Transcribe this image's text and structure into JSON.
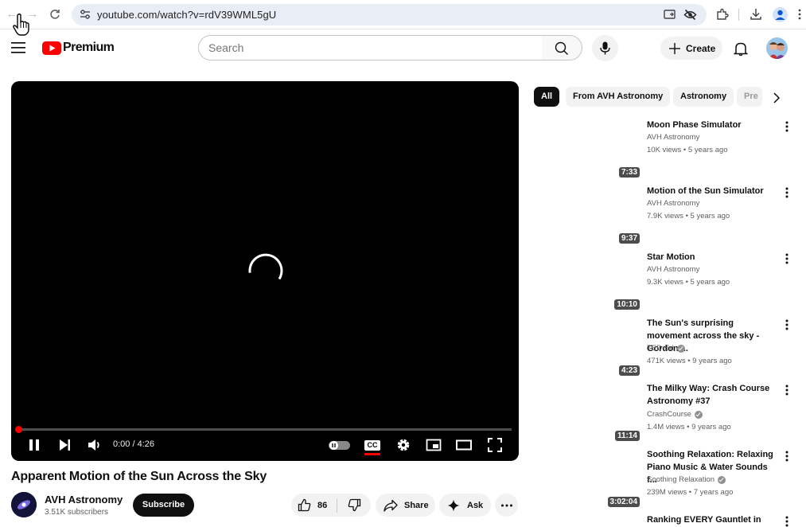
{
  "browser": {
    "url": "youtube.com/watch?v=rdV39WML5gU"
  },
  "header": {
    "logo_text": "Premium",
    "search_placeholder": "Search",
    "create_label": "Create"
  },
  "player": {
    "time": "0:00 / 4:26",
    "progress": 0.0
  },
  "video": {
    "title": "Apparent Motion of the Sun Across the Sky",
    "channel": "AVH Astronomy",
    "subscribers": "3.51K subscribers",
    "subscribe_label": "Subscribe",
    "likes": "86",
    "share_label": "Share",
    "ask_label": "Ask"
  },
  "chips": [
    "All",
    "From AVH Astronomy",
    "Astronomy",
    "Pre"
  ],
  "recommended": [
    {
      "title": "Moon Phase Simulator",
      "channel": "AVH Astronomy",
      "verified": false,
      "meta": "10K views • 5 years ago",
      "duration": "7:33"
    },
    {
      "title": "Motion of the Sun Simulator",
      "channel": "AVH Astronomy",
      "verified": false,
      "meta": "7.9K views • 5 years ago",
      "duration": "9:37"
    },
    {
      "title": "Star Motion",
      "channel": "AVH Astronomy",
      "verified": false,
      "meta": "9.3K views • 5 years ago",
      "duration": "10:10"
    },
    {
      "title": "The Sun's surprising movement across the sky - Gordon ...",
      "channel": "TED-Ed",
      "verified": true,
      "meta": "471K views • 9 years ago",
      "duration": "4:23"
    },
    {
      "title": "The Milky Way: Crash Course Astronomy #37",
      "channel": "CrashCourse",
      "verified": true,
      "meta": "1.4M views • 9 years ago",
      "duration": "11:14"
    },
    {
      "title": "Soothing Relaxation: Relaxing Piano Music & Water Sounds f...",
      "channel": "Soothing Relaxation",
      "verified": true,
      "meta": "239M views • 7 years ago",
      "duration": "3:02:04"
    },
    {
      "title": "Ranking EVERY Gauntlet in",
      "channel": "",
      "verified": false,
      "meta": "",
      "duration": ""
    }
  ]
}
